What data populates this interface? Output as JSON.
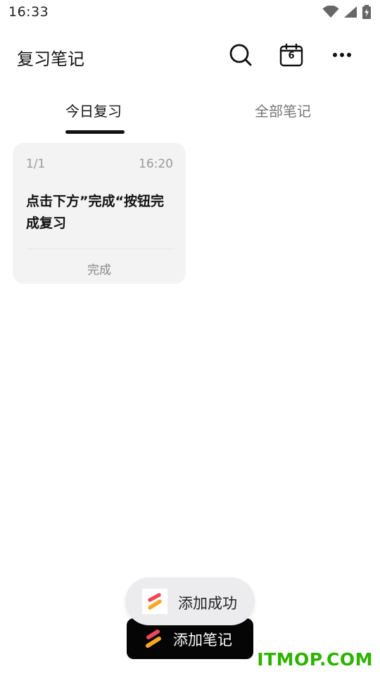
{
  "status_bar": {
    "time": "16:33",
    "icons": [
      "wifi-icon",
      "cellular-signal-icon",
      "battery-charging-icon"
    ]
  },
  "app_bar": {
    "title": "复习笔记",
    "actions": [
      "search-icon",
      "calendar-icon",
      "more-icon"
    ],
    "calendar_day": "6"
  },
  "tabs": [
    {
      "label": "今日复习",
      "selected": true
    },
    {
      "label": "全部笔记",
      "selected": false
    }
  ],
  "notes": [
    {
      "index": "1/1",
      "time": "16:20",
      "content": "点击下方”完成“按钮完成复习",
      "action": "完成"
    }
  ],
  "toast": {
    "text": "添加成功"
  },
  "add_button": {
    "label": "添加笔记"
  },
  "watermark": {
    "text": "ITMOP.COM"
  },
  "colors": {
    "background": "#ffffff",
    "card": "#f3f3f3",
    "primary_button": "#050505",
    "logo_red": "#f0475a",
    "logo_orange": "#f7a823",
    "watermark": "#2db300"
  }
}
